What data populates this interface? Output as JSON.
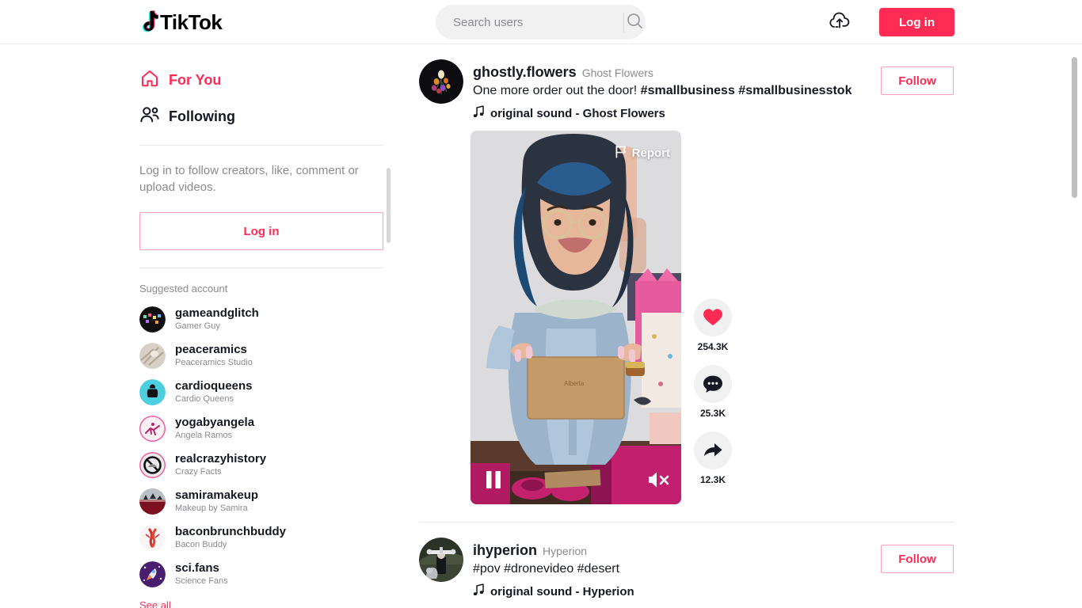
{
  "header": {
    "logo_text": "TikTok",
    "logo_icon": "tiktok-note-icon",
    "search": {
      "placeholder": "Search users",
      "value": "",
      "icon": "search-icon"
    },
    "upload_icon": "cloud-upload-icon",
    "login_label": "Log in"
  },
  "sidebar": {
    "nav": [
      {
        "label": "For You",
        "icon": "home-icon",
        "active": true
      },
      {
        "label": "Following",
        "icon": "people-icon",
        "active": false
      }
    ],
    "login_prompt": "Log in to follow creators, like, comment or upload videos.",
    "login_label": "Log in",
    "suggested_title": "Suggested account",
    "accounts": [
      {
        "name": "gameandglitch",
        "nickname": "Gamer Guy",
        "avatar_color": "#101010"
      },
      {
        "name": "peaceramics",
        "nickname": "Peaceramics Studio",
        "avatar_color": "#cdc3b6"
      },
      {
        "name": "cardioqueens",
        "nickname": "Cardio Queens",
        "avatar_color": "#4ecfe0"
      },
      {
        "name": "yogabyangela",
        "nickname": "Angela Ramos",
        "avatar_color": "#f7d9df"
      },
      {
        "name": "realcrazyhistory",
        "nickname": "Crazy Facts",
        "avatar_color": "#e8e8e8"
      },
      {
        "name": "samiramakeup",
        "nickname": "Makeup by Samira",
        "avatar_color": "#7d1020"
      },
      {
        "name": "baconbrunchbuddy",
        "nickname": "Bacon Buddy",
        "avatar_color": "#f6f4f3"
      },
      {
        "name": "sci.fans",
        "nickname": "Science Fans",
        "avatar_color": "#4a1e6e"
      }
    ],
    "see_all_label": "See all"
  },
  "feed": {
    "posts": [
      {
        "author": "ghostly.flowers",
        "nickname": "Ghost Flowers",
        "caption_text": "One more order out the door! ",
        "caption_tags": "#smallbusiness #smallbusinesstok",
        "music_icon": "music-note-icon",
        "music": "original sound - Ghost Flowers",
        "follow_label": "Follow",
        "report_label": "Report",
        "report_icon": "flag-icon",
        "play_state": "pause-icon",
        "volume_state": "muted-icon",
        "actions": [
          {
            "icon": "heart-icon",
            "count": "254.3K",
            "name": "like"
          },
          {
            "icon": "comment-icon",
            "count": "25.3K",
            "name": "comment"
          },
          {
            "icon": "share-icon",
            "count": "12.3K",
            "name": "share"
          }
        ]
      },
      {
        "author": "ihyperion",
        "nickname": "Hyperion",
        "caption_text": "",
        "caption_tags": "#pov #dronevideo #desert",
        "music_icon": "music-note-icon",
        "music": "original sound - Hyperion",
        "follow_label": "Follow"
      }
    ]
  },
  "colors": {
    "brand_red": "#fe2c55",
    "brand_cyan": "#25f4ee",
    "text": "#161823",
    "muted": "#8a8b91"
  }
}
